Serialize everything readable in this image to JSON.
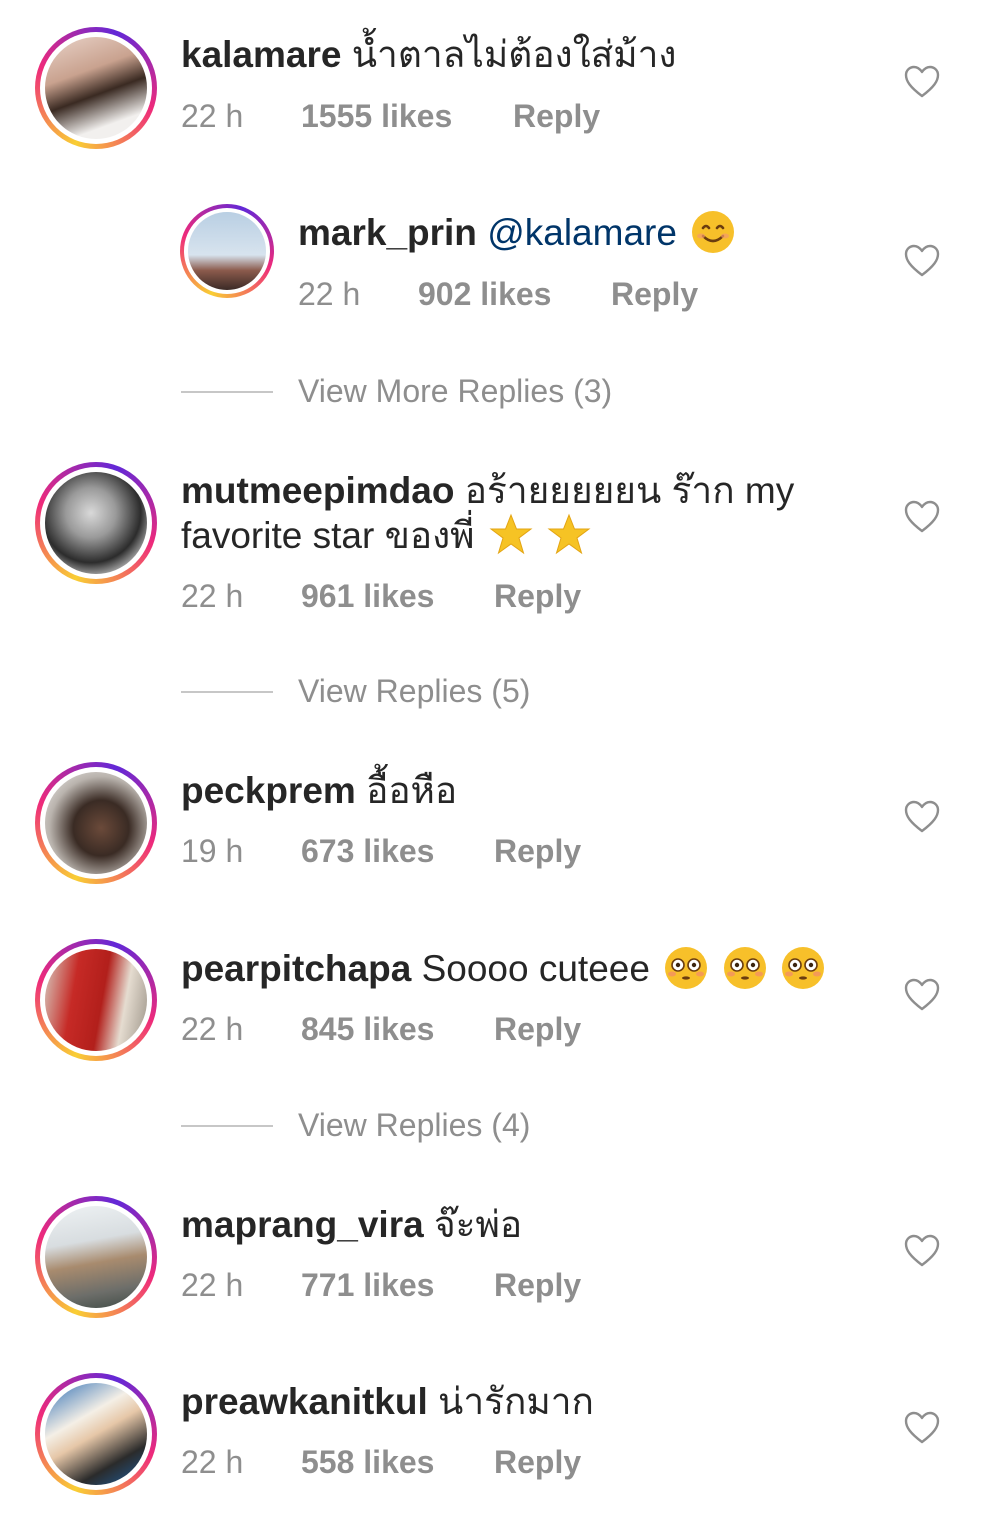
{
  "colors": {
    "text": "#262626",
    "meta": "#8e8e8e",
    "mention": "#003569",
    "heart_stroke": "#8e8e8e",
    "ring_start": "#f9ce34",
    "ring_end": "#ee2a7b"
  },
  "comments": [
    {
      "username": "kalamare",
      "text": "น้ำตาลไม่ต้องใส่ม้าง",
      "time": "22 h",
      "likes": "1555 likes",
      "reply": "Reply",
      "avatar_icon": "profile-photo",
      "like_icon": "heart-outline-icon"
    },
    {
      "username": "mark_prin",
      "mention": "@kalamare",
      "emoji": "smiling-face-emoji",
      "time": "22 h",
      "likes": "902 likes",
      "reply": "Reply",
      "avatar_icon": "profile-photo",
      "like_icon": "heart-outline-icon"
    },
    {
      "username": "mutmeepimdao",
      "text_line1": "อร้ายยยยยน ร๊าก my",
      "text_line2": "favorite star ของพี่",
      "emoji": "star-emoji",
      "time": "22 h",
      "likes": "961 likes",
      "reply": "Reply",
      "avatar_icon": "profile-photo",
      "like_icon": "heart-outline-icon"
    },
    {
      "username": "peckprem",
      "text": "อื้อหือ",
      "time": "19 h",
      "likes": "673 likes",
      "reply": "Reply",
      "avatar_icon": "profile-photo",
      "like_icon": "heart-outline-icon"
    },
    {
      "username": "pearpitchapa",
      "text": "Soooo cuteee",
      "emoji": "flushed-face-emoji",
      "time": "22 h",
      "likes": "845 likes",
      "reply": "Reply",
      "avatar_icon": "profile-photo",
      "like_icon": "heart-outline-icon"
    },
    {
      "username": "maprang_vira",
      "text": "จ๊ะพ่อ",
      "time": "22 h",
      "likes": "771 likes",
      "reply": "Reply",
      "avatar_icon": "profile-photo",
      "like_icon": "heart-outline-icon"
    },
    {
      "username": "preawkanitkul",
      "text": "น่ารักมาก",
      "time": "22 h",
      "likes": "558 likes",
      "reply": "Reply",
      "avatar_icon": "profile-photo",
      "like_icon": "heart-outline-icon"
    }
  ],
  "view_replies": [
    {
      "label": "View More Replies (3)"
    },
    {
      "label": "View Replies (5)"
    },
    {
      "label": "View Replies (4)"
    }
  ]
}
